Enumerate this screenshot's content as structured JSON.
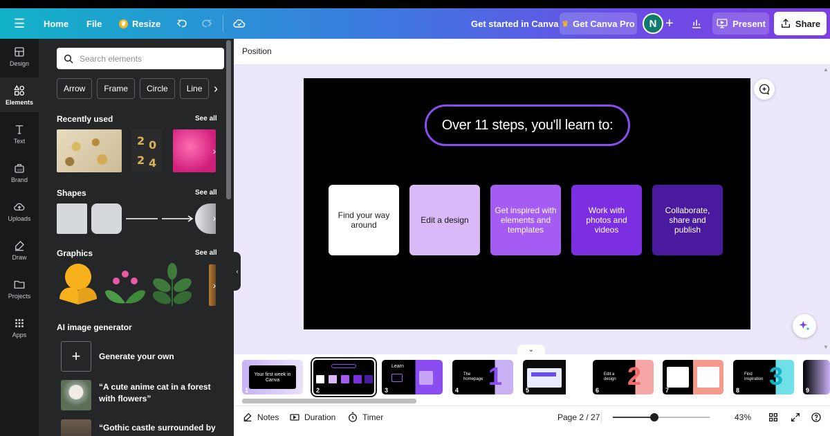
{
  "topbar": {
    "home": "Home",
    "file": "File",
    "resize": "Resize",
    "get_started": "Get started in Canva",
    "get_pro": "Get Canva Pro",
    "avatar_initial": "N",
    "present": "Present",
    "share": "Share"
  },
  "rail": [
    {
      "label": "Design",
      "icon": "design-icon"
    },
    {
      "label": "Elements",
      "icon": "elements-icon"
    },
    {
      "label": "Text",
      "icon": "text-icon"
    },
    {
      "label": "Brand",
      "icon": "brand-icon"
    },
    {
      "label": "Uploads",
      "icon": "uploads-icon"
    },
    {
      "label": "Draw",
      "icon": "draw-icon"
    },
    {
      "label": "Projects",
      "icon": "projects-icon"
    },
    {
      "label": "Apps",
      "icon": "apps-icon"
    }
  ],
  "panel": {
    "search_placeholder": "Search elements",
    "chips": [
      "Arrow",
      "Frame",
      "Circle",
      "Line"
    ],
    "recently_used": "Recently used",
    "shapes": "Shapes",
    "graphics": "Graphics",
    "see_all": "See all",
    "ai_title": "AI image generator",
    "generate_own": "Generate your own",
    "prompt_1": "“A cute anime cat in a forest with flowers”",
    "prompt_2": "“Gothic castle surrounded by"
  },
  "editor": {
    "position": "Position",
    "slide_title": "Over 11 steps, you'll learn to:",
    "cards": [
      {
        "text": "Find your way around",
        "bg": "#ffffff",
        "fg": "#1a1a1a"
      },
      {
        "text": "Edit a design",
        "bg": "#d9b9f7",
        "fg": "#1a1a1a"
      },
      {
        "text": "Get inspired with elements and templates",
        "bg": "#a45cf3",
        "fg": "#ffffff"
      },
      {
        "text": "Work with photos and videos",
        "bg": "#7b2fe0",
        "fg": "#ffffff"
      },
      {
        "text": "Collaborate, share and publish",
        "bg": "#4a1a9e",
        "fg": "#ffffff"
      }
    ],
    "pages": [
      {
        "num": "1",
        "label": "Your first week in Canva"
      },
      {
        "num": "2",
        "label": ""
      },
      {
        "num": "3",
        "label": "Learn"
      },
      {
        "num": "4",
        "label": "The homepage"
      },
      {
        "num": "5",
        "label": ""
      },
      {
        "num": "6",
        "label": "Edit a design"
      },
      {
        "num": "7",
        "label": ""
      },
      {
        "num": "8",
        "label": "Find inspiration"
      },
      {
        "num": "9",
        "label": ""
      }
    ]
  },
  "footer": {
    "notes": "Notes",
    "duration": "Duration",
    "timer": "Timer",
    "page": "Page 2 / 27",
    "zoom": "43%",
    "zoom_level": 0.43
  },
  "colors": {
    "accent_purple": "#8b4cf0",
    "canvas_bg": "#ece7fb",
    "panel_bg": "#252627"
  }
}
